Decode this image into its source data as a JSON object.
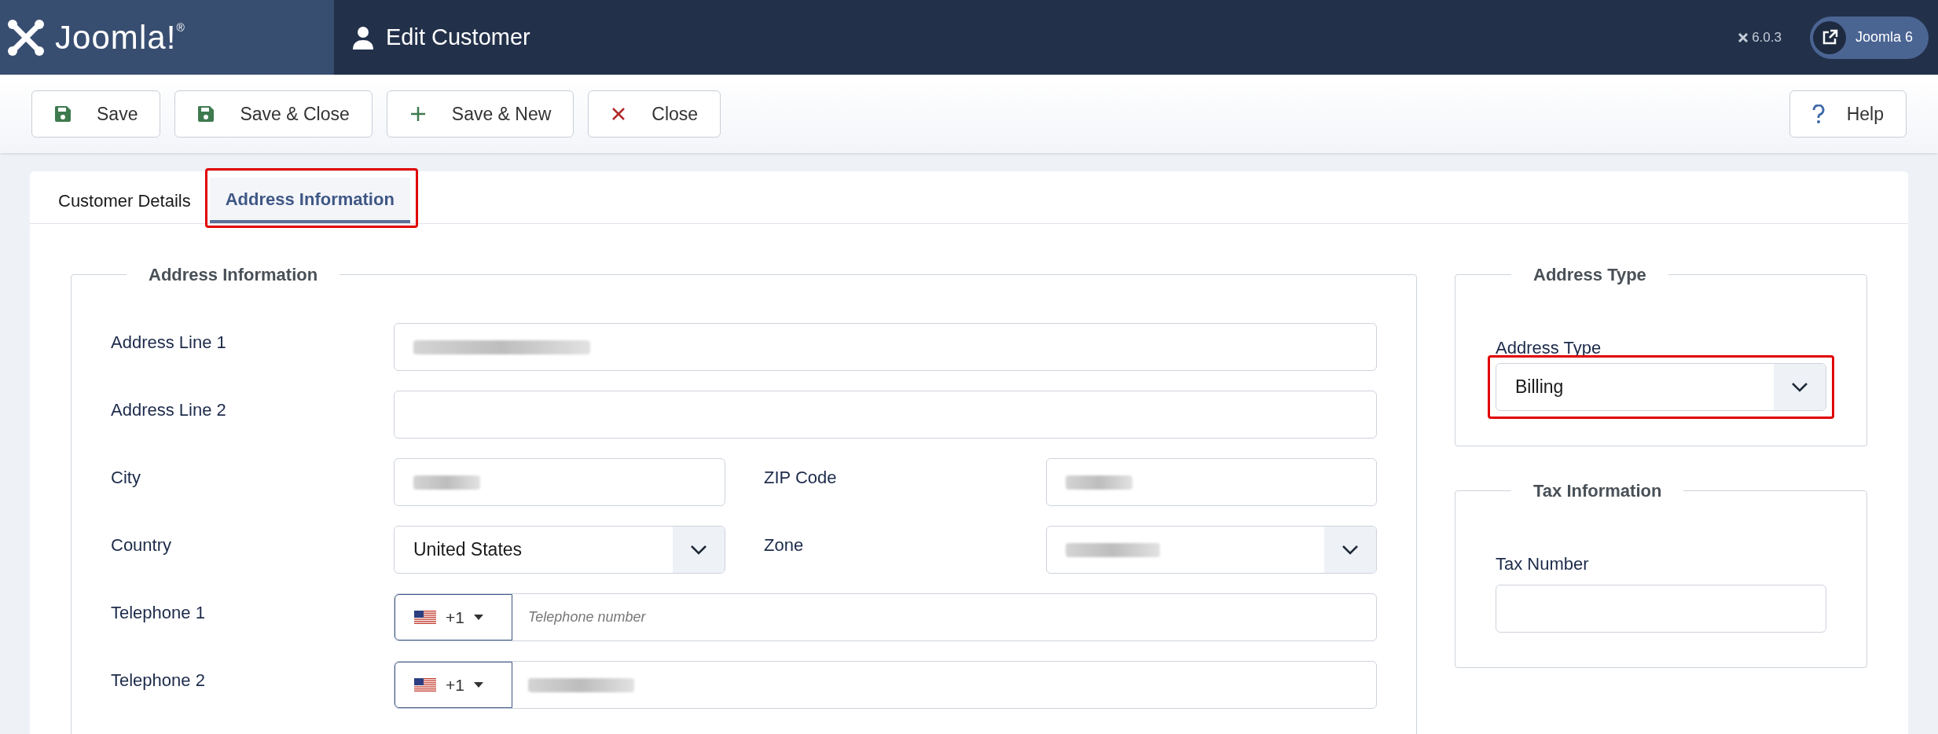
{
  "header": {
    "logo_text": "Joomla!$^{®}$",
    "title": "Edit Customer",
    "version": "6.0.3",
    "site_link": "Joomla 6"
  },
  "toolbar": {
    "buttons": [
      {
        "label": "Save",
        "kind": "save"
      },
      {
        "label": "Save & Close",
        "kind": "save"
      },
      {
        "label": "Save & New",
        "kind": "new"
      },
      {
        "label": "Close",
        "kind": "close"
      }
    ],
    "help": "Help"
  },
  "tabs": [
    {
      "label": "Customer Details",
      "selected": false,
      "highlighted": false
    },
    {
      "label": "Address Information",
      "selected": true,
      "highlighted": true
    }
  ],
  "address_section": {
    "legend": "Address Information",
    "rows": [
      [
        {
          "label": "Address Line 1",
          "kind": "text",
          "redacted": true
        }
      ],
      [
        {
          "label": "Address Line 2",
          "kind": "text",
          "redacted": false
        }
      ],
      [
        {
          "label": "City",
          "kind": "text",
          "redacted": true
        },
        {
          "label": "ZIP Code",
          "kind": "text",
          "redacted": true
        }
      ],
      [
        {
          "label": "Country",
          "kind": "select",
          "value": "United States",
          "redacted": false
        },
        {
          "label": "Zone",
          "kind": "select",
          "redacted": true
        }
      ],
      [
        {
          "label": "Telephone 1",
          "kind": "phone",
          "dial_code": "+1",
          "placeholder": "Telephone number",
          "redacted": false
        }
      ],
      [
        {
          "label": "Telephone 2",
          "kind": "phone",
          "dial_code": "+1",
          "redacted": true
        }
      ]
    ]
  },
  "address_type_section": {
    "legend": "Address Type",
    "label": "Address Type",
    "value": "Billing",
    "highlighted": true
  },
  "tax_section": {
    "legend": "Tax Information",
    "label": "Tax Number"
  }
}
